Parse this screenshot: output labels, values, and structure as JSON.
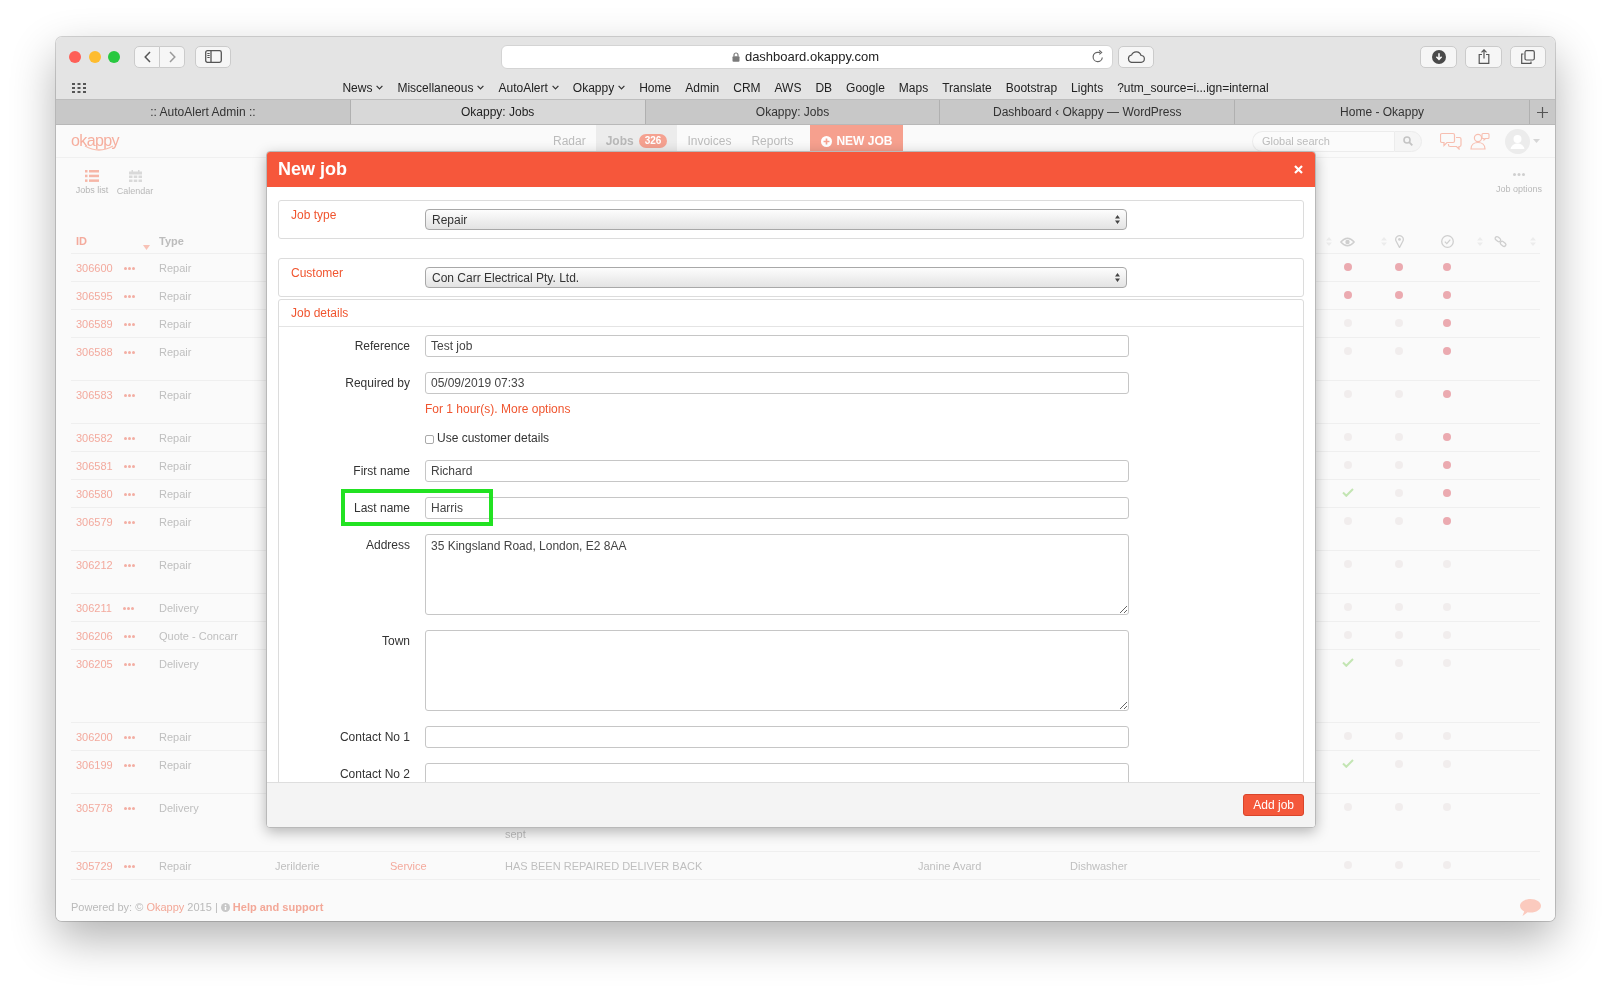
{
  "browser": {
    "url": "dashboard.okappy.com",
    "bookmarks": [
      {
        "label": "News",
        "menu": true
      },
      {
        "label": "Miscellaneous",
        "menu": true
      },
      {
        "label": "AutoAlert",
        "menu": true
      },
      {
        "label": "Okappy",
        "menu": true
      },
      {
        "label": "Home",
        "menu": false
      },
      {
        "label": "Admin",
        "menu": false
      },
      {
        "label": "CRM",
        "menu": false
      },
      {
        "label": "AWS",
        "menu": false
      },
      {
        "label": "DB",
        "menu": false
      },
      {
        "label": "Google",
        "menu": false
      },
      {
        "label": "Maps",
        "menu": false
      },
      {
        "label": "Translate",
        "menu": false
      },
      {
        "label": "Bootstrap",
        "menu": false
      },
      {
        "label": "Lights",
        "menu": false
      },
      {
        "label": "?utm_source=i...ign=internal",
        "menu": false
      }
    ],
    "tabs": [
      {
        "title": ":: AutoAlert Admin ::",
        "selected": false
      },
      {
        "title": "Okappy: Jobs",
        "selected": true
      },
      {
        "title": "Okappy: Jobs",
        "selected": false
      },
      {
        "title": "Dashboard ‹ Okappy — WordPress",
        "selected": false
      },
      {
        "title": "Home - Okappy",
        "selected": false
      }
    ]
  },
  "app": {
    "logo": "okappy",
    "nav": [
      {
        "label": "Radar",
        "selected": false
      },
      {
        "label": "Jobs",
        "badge": "326",
        "selected": true
      },
      {
        "label": "Invoices",
        "selected": false
      },
      {
        "label": "Reports",
        "selected": false
      }
    ],
    "new_job": "NEW JOB",
    "search": {
      "placeholder": "Global search"
    },
    "views": [
      {
        "label": "Jobs list",
        "selected": true
      },
      {
        "label": "Calendar",
        "selected": false
      }
    ],
    "job_options": "Job options",
    "table": {
      "columns": [
        {
          "label": "ID",
          "sorted": true
        },
        {
          "label": "Type",
          "sorted": false
        }
      ],
      "rows": [
        {
          "id": "306600",
          "type": "Repair",
          "status": [
            {
              "kind": "dot",
              "color": "#ebaab0"
            },
            {
              "kind": "dot",
              "color": "#ebaab0"
            },
            {
              "kind": "dot",
              "color": "#ebaab0"
            }
          ]
        },
        {
          "id": "306595",
          "type": "Repair",
          "status": [
            {
              "kind": "dot",
              "color": "#ebaab0"
            },
            {
              "kind": "dot",
              "color": "#ebaab0"
            },
            {
              "kind": "dot",
              "color": "#ebaab0"
            }
          ]
        },
        {
          "id": "306589",
          "type": "Repair",
          "status": [
            {
              "kind": "dot",
              "color": "#f1eded"
            },
            {
              "kind": "dot",
              "color": "#f1eded"
            },
            {
              "kind": "dot",
              "color": "#ebaab0"
            }
          ]
        },
        {
          "id": "306588",
          "type": "Repair",
          "status": [
            {
              "kind": "dot",
              "color": "#f1eded"
            },
            {
              "kind": "dot",
              "color": "#f1eded"
            },
            {
              "kind": "dot",
              "color": "#ebaab0"
            }
          ]
        },
        {
          "id": "306583",
          "type": "Repair",
          "status": [
            {
              "kind": "dot",
              "color": "#f1eded"
            },
            {
              "kind": "dot",
              "color": "#f1eded"
            },
            {
              "kind": "dot",
              "color": "#ebaab0"
            }
          ]
        },
        {
          "id": "306582",
          "type": "Repair",
          "status": [
            {
              "kind": "dot",
              "color": "#f1eded"
            },
            {
              "kind": "dot",
              "color": "#f1eded"
            },
            {
              "kind": "dot",
              "color": "#ebaab0"
            }
          ]
        },
        {
          "id": "306581",
          "type": "Repair",
          "status": [
            {
              "kind": "dot",
              "color": "#f1eded"
            },
            {
              "kind": "dot",
              "color": "#f1eded"
            },
            {
              "kind": "dot",
              "color": "#ebaab0"
            }
          ]
        },
        {
          "id": "306580",
          "type": "Repair",
          "status": [
            {
              "kind": "tick"
            },
            {
              "kind": "dot",
              "color": "#f1eded"
            },
            {
              "kind": "dot",
              "color": "#ebaab0"
            }
          ]
        },
        {
          "id": "306579",
          "type": "Repair",
          "status": [
            {
              "kind": "dot",
              "color": "#f1eded"
            },
            {
              "kind": "dot",
              "color": "#f1eded"
            },
            {
              "kind": "dot",
              "color": "#ebaab0"
            }
          ]
        },
        {
          "id": "306212",
          "type": "Repair",
          "status": [
            {
              "kind": "dot",
              "color": "#f1eded"
            },
            {
              "kind": "dot",
              "color": "#f1eded"
            },
            {
              "kind": "dot",
              "color": "#f1eded"
            }
          ]
        },
        {
          "id": "306211",
          "type": "Delivery",
          "status": [
            {
              "kind": "dot",
              "color": "#f1eded"
            },
            {
              "kind": "dot",
              "color": "#f1eded"
            },
            {
              "kind": "dot",
              "color": "#f1eded"
            }
          ]
        },
        {
          "id": "306206",
          "type": "Quote - Concarr",
          "status": [
            {
              "kind": "dot",
              "color": "#f1eded"
            },
            {
              "kind": "dot",
              "color": "#f1eded"
            },
            {
              "kind": "dot",
              "color": "#f1eded"
            }
          ]
        },
        {
          "id": "306205",
          "type": "Delivery",
          "status": [
            {
              "kind": "tick"
            },
            {
              "kind": "dot",
              "color": "#f1eded"
            },
            {
              "kind": "dot",
              "color": "#f1eded"
            }
          ]
        },
        {
          "id": "306200",
          "type": "Repair",
          "status": [
            {
              "kind": "dot",
              "color": "#f1eded"
            },
            {
              "kind": "dot",
              "color": "#f1eded"
            },
            {
              "kind": "dot",
              "color": "#f1eded"
            }
          ]
        },
        {
          "id": "306199",
          "type": "Repair",
          "status": [
            {
              "kind": "tick"
            },
            {
              "kind": "dot",
              "color": "#f1eded"
            },
            {
              "kind": "dot",
              "color": "#f1eded"
            }
          ]
        },
        {
          "id": "305778",
          "type": "Delivery",
          "column_5_last_line": "sept",
          "status": [
            {
              "kind": "dot",
              "color": "#f1eded"
            },
            {
              "kind": "dot",
              "color": "#f1eded"
            },
            {
              "kind": "dot",
              "color": "#f1eded"
            }
          ]
        },
        {
          "id": "305729",
          "type": "Repair",
          "column_3": "Jerilderie",
          "column_4": "Service",
          "column_5": "HAS BEEN REPAIRED DELIVER BACK",
          "column_6": "Janine Avard",
          "column_7": "Dishwasher",
          "status": [
            {
              "kind": "dot",
              "color": "#f1eded"
            },
            {
              "kind": "dot",
              "color": "#f1eded"
            },
            {
              "kind": "dot",
              "color": "#f1eded"
            }
          ]
        }
      ]
    },
    "footer": {
      "prefix": "Powered by: ©",
      "brand": "Okappy",
      "year": "2015 |",
      "help": "Help and support"
    }
  },
  "modal": {
    "title": "New job",
    "job_type": {
      "label": "Job type",
      "value": "Repair"
    },
    "customer": {
      "label": "Customer",
      "value": "Con Carr Electrical Pty. Ltd."
    },
    "details": {
      "title": "Job details",
      "fields": [
        {
          "kind": "input",
          "label": "Reference",
          "value": "Test job",
          "highlighted": false
        },
        {
          "kind": "input",
          "label": "Required by",
          "value": "05/09/2019 07:33",
          "note": "For 1 hour(s).",
          "link": "More options",
          "highlighted": false
        },
        {
          "kind": "checkbox",
          "label": "Use customer details",
          "checked": false,
          "highlighted": false
        },
        {
          "kind": "input",
          "label": "First name",
          "value": "Richard",
          "highlighted": false
        },
        {
          "kind": "input",
          "label": "Last name",
          "value": "Harris",
          "highlighted": true
        },
        {
          "kind": "textarea",
          "label": "Address",
          "value": "35 Kingsland Road, London, E2 8AA",
          "highlighted": false
        },
        {
          "kind": "textarea",
          "label": "Town",
          "highlighted": false
        },
        {
          "kind": "input",
          "label": "Contact No 1",
          "highlighted": false
        },
        {
          "kind": "input",
          "label": "Contact No 2",
          "highlighted": false
        }
      ]
    },
    "submit": "Add job"
  }
}
